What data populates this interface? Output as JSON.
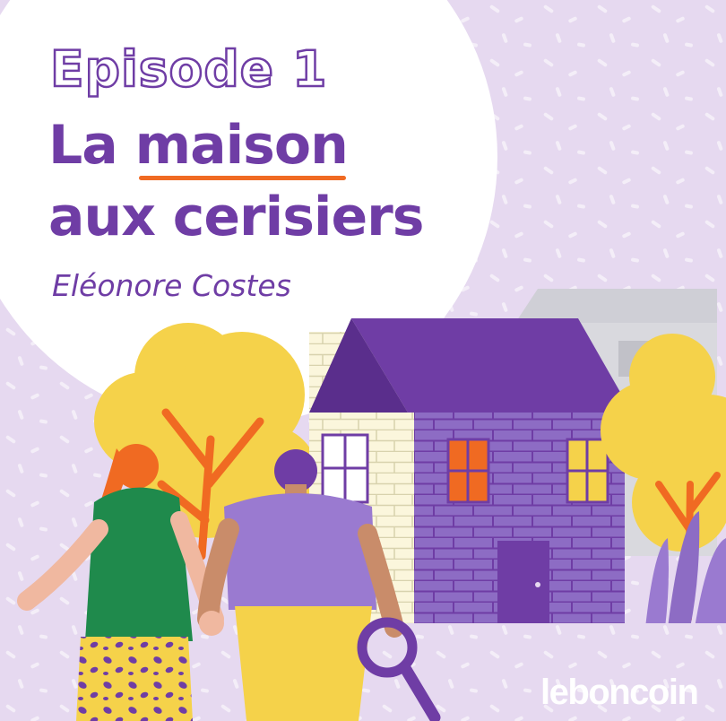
{
  "episode_label": "Episode 1",
  "title_line1_prefix": "La ",
  "title_line1_highlight": "maison",
  "title_line2": "aux cerisiers",
  "author": "Eléonore Costes",
  "brand": "leboncoin",
  "colors": {
    "background": "#e6d9f0",
    "circle": "#ffffff",
    "primary_purple": "#6f3da5",
    "accent_orange": "#f06a22",
    "tree_yellow": "#f5d24a",
    "brick_light": "#8d6cc4"
  },
  "icons": [
    "tree-icon",
    "house-icon",
    "couple-icon",
    "magnifier-icon"
  ]
}
